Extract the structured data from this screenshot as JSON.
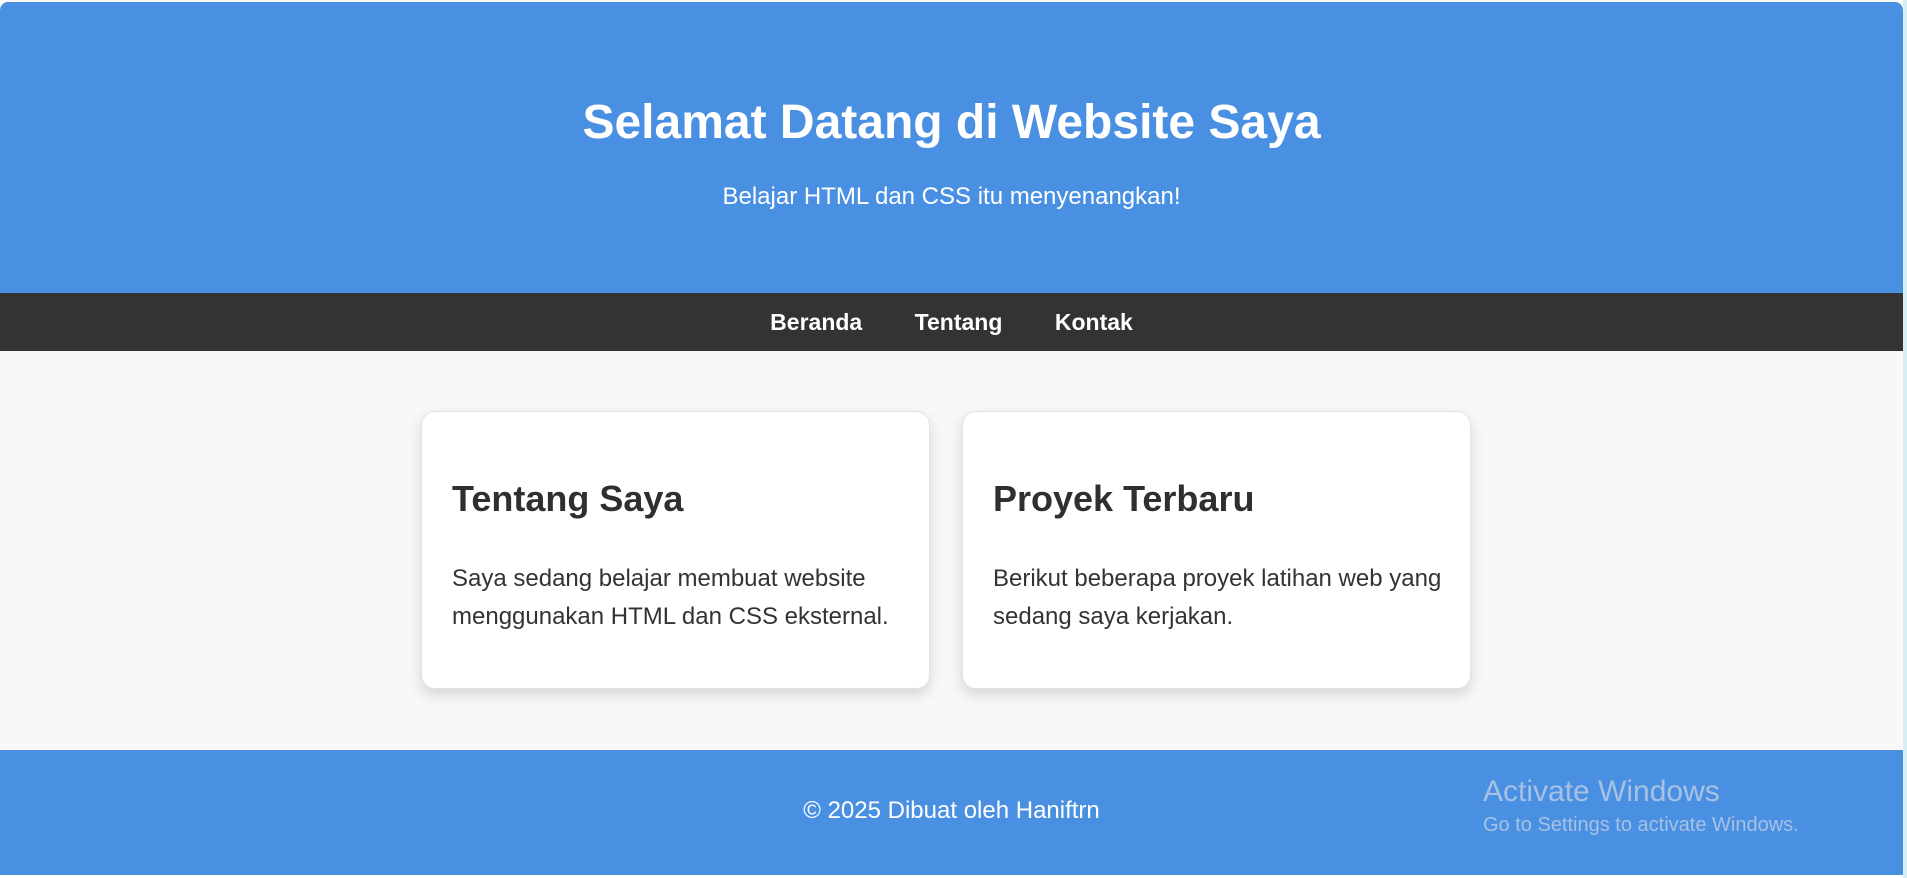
{
  "header": {
    "title": "Selamat Datang di Website Saya",
    "subtitle": "Belajar HTML dan CSS itu menyenangkan!"
  },
  "nav": {
    "items": [
      {
        "label": "Beranda"
      },
      {
        "label": "Tentang"
      },
      {
        "label": "Kontak"
      }
    ]
  },
  "cards": [
    {
      "title": "Tentang Saya",
      "text": "Saya sedang belajar membuat website menggunakan HTML dan CSS eksternal."
    },
    {
      "title": "Proyek Terbaru",
      "text": "Berikut beberapa proyek latihan web yang sedang saya kerjakan."
    }
  ],
  "footer": {
    "text": "© 2025 Dibuat oleh Haniftrn"
  },
  "watermark": {
    "title": "Activate Windows",
    "subtitle": "Go to Settings to activate Windows."
  },
  "colors": {
    "primary_blue": "#4a90e2",
    "nav_dark": "#333333",
    "page_background": "#f8f8f8",
    "card_background": "#ffffff"
  }
}
